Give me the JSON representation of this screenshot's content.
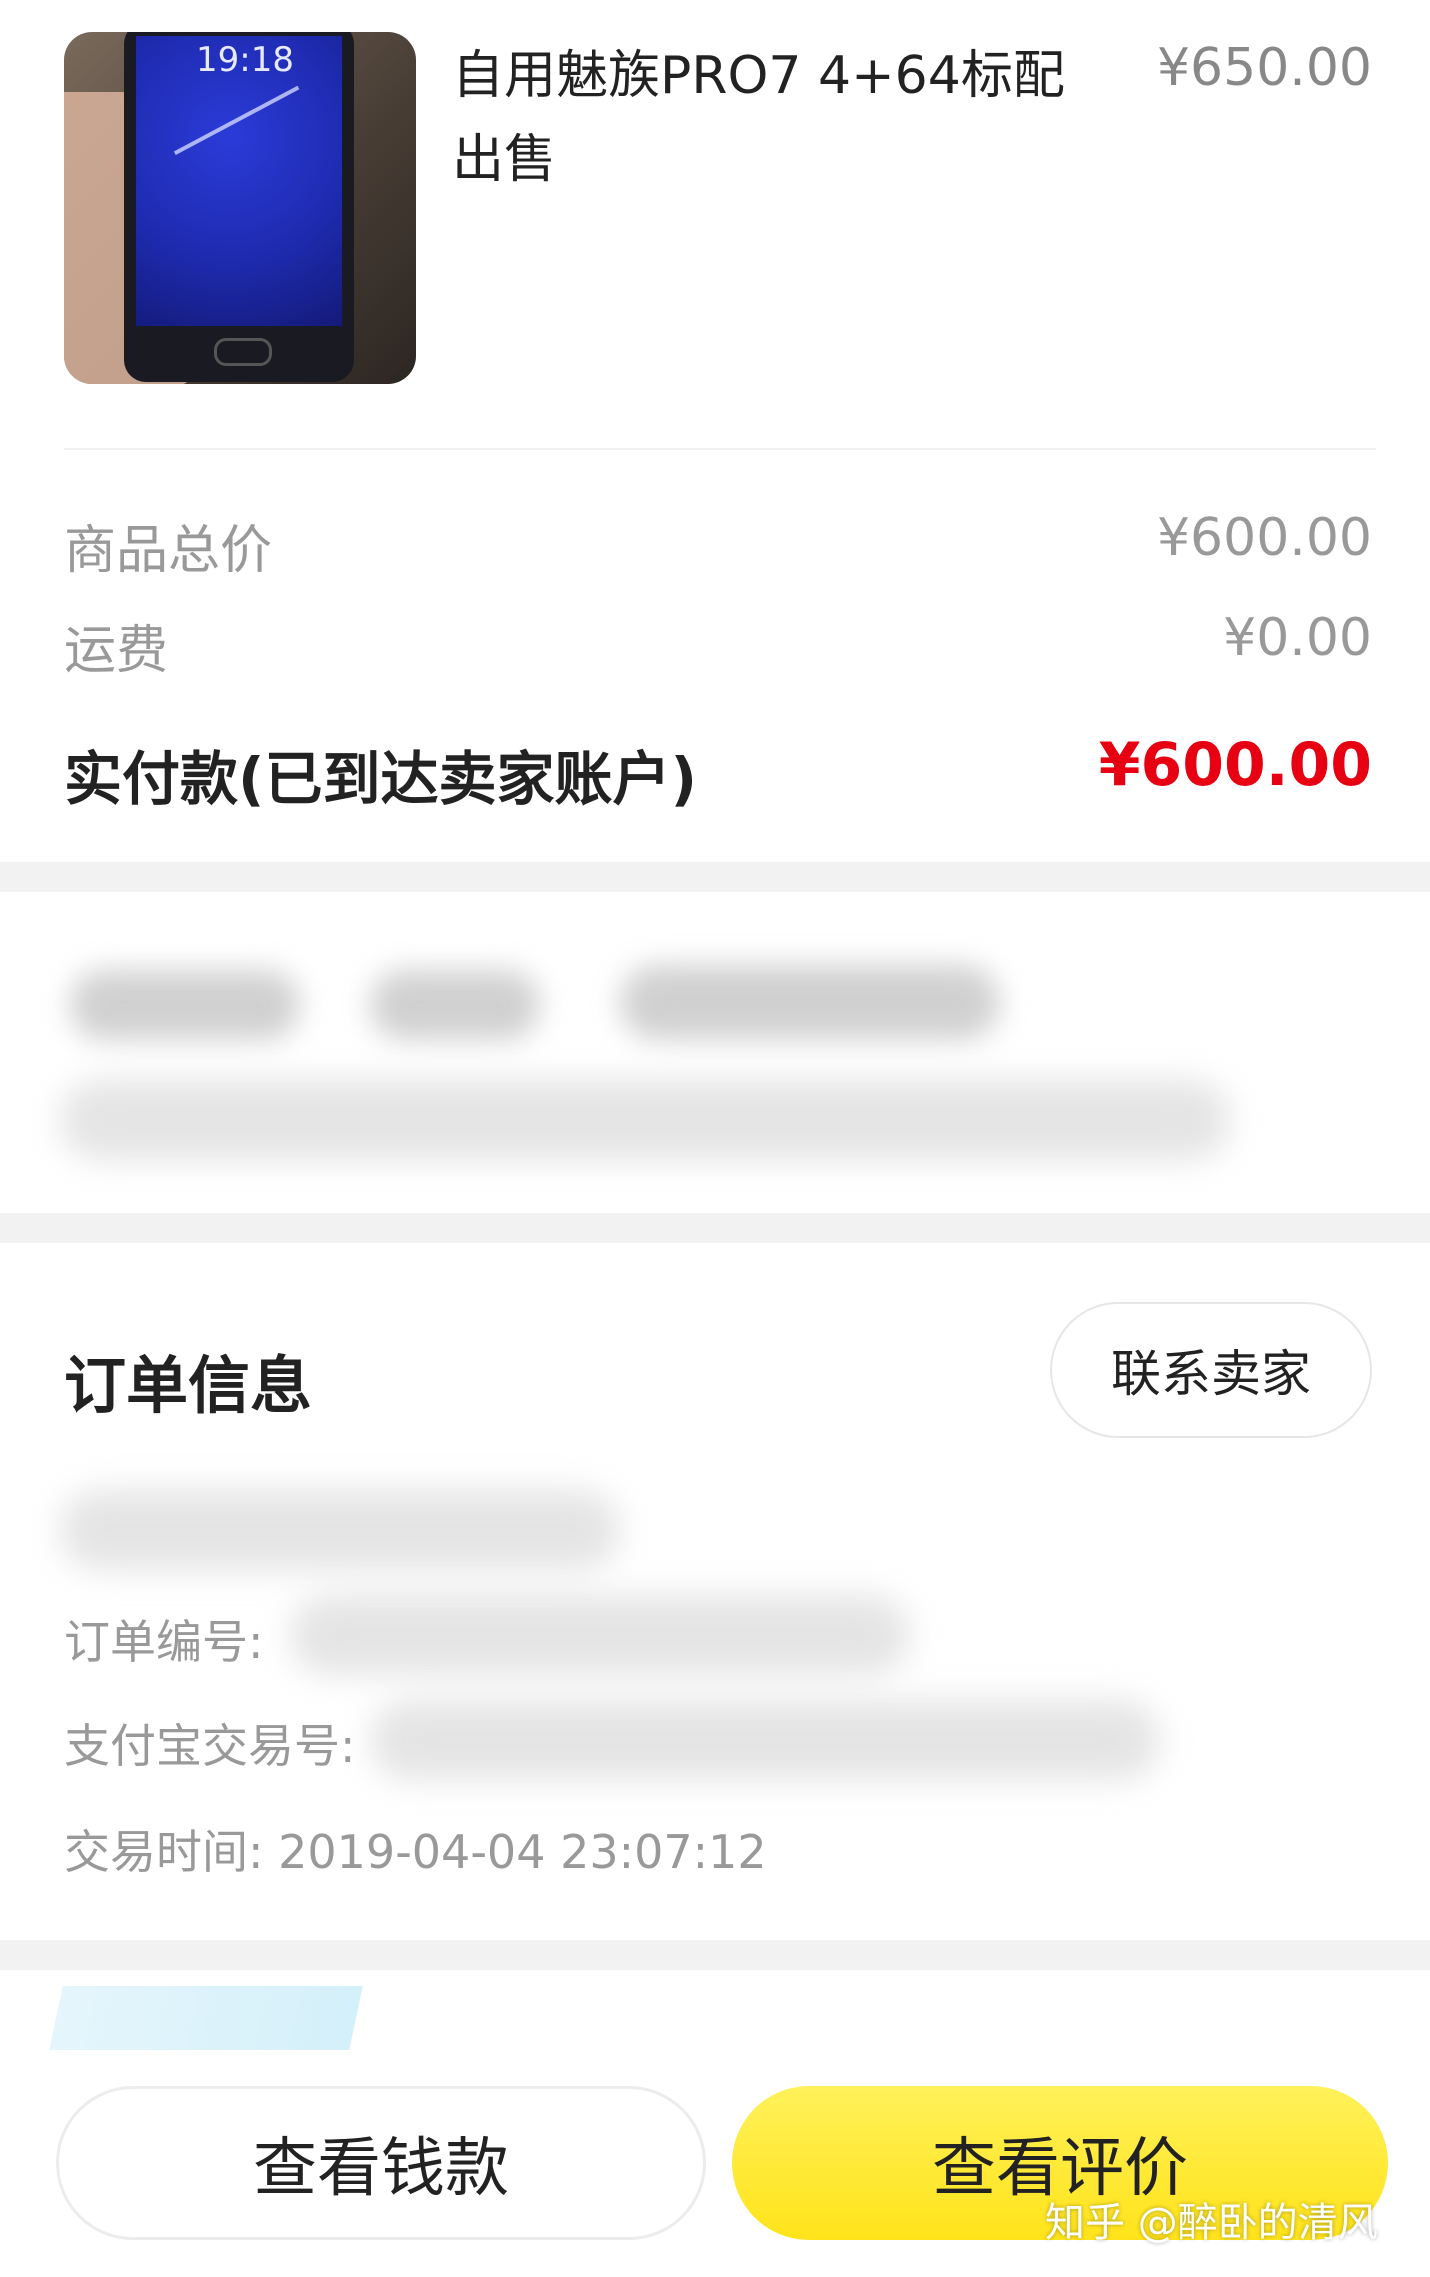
{
  "product": {
    "title_line1": "自用魅族PRO7  4+64标配",
    "title_line2": "出售",
    "price": "¥650.00",
    "thumb_clock": "19:18"
  },
  "summary": {
    "goods_total_label": "商品总价",
    "goods_total_value": "¥600.00",
    "shipping_label": "运费",
    "shipping_value": "¥0.00",
    "paid_label": "实付款(已到达卖家账户)",
    "paid_value": "¥600.00",
    "paid_color": "#e60012"
  },
  "order_info": {
    "title": "订单信息",
    "contact_seller": "联系卖家",
    "order_no_label": "订单编号:",
    "alipay_no_label": "支付宝交易号:",
    "trade_time_label": "交易时间:",
    "trade_time_value": "2019-04-04 23:07:12"
  },
  "actions": {
    "view_money": "查看钱款",
    "view_review": "查看评价",
    "accent": "#ffe31a"
  },
  "watermark": "知乎 @醉卧的清风"
}
